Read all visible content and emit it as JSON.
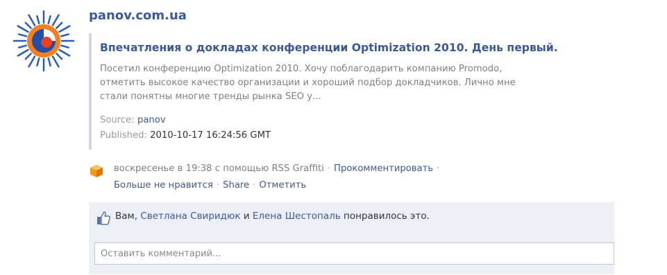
{
  "author": {
    "name": "panov.com.ua",
    "avatar_icon": "sun-logo-icon"
  },
  "post": {
    "title": "Впечатления о докладах конференции Optimization 2010. День первый.",
    "body_lines": [
      "Посетил конференцию Optimization 2010. Хочу поблагодарить компанию Promodo,",
      "отметить высокое качество организации и хороший подбор докладчиков. Лично мне",
      "стали понятны многие тренды рынка SEO у..."
    ],
    "source_label": "Source:",
    "source_value": "panov",
    "published_label": "Published:",
    "published_value": "2010-10-17 16:24:56 GMT"
  },
  "actions": {
    "app_icon": "rss-graffiti-icon",
    "time": "воскресенье в 19:38",
    "via": "с помощью",
    "app_name": "RSS Graffiti",
    "comment_link": "Прокомментировать",
    "unlike_link": "Больше не нравится",
    "share_link": "Share",
    "tag_link": "Отметить",
    "separator": "·"
  },
  "likes": {
    "icon": "thumbs-up-icon",
    "you": "Вам,",
    "person1": "Светлана Свиридюк",
    "conj": "и",
    "person2": "Елена Шестопаль",
    "suffix": "понравилось это."
  },
  "comment": {
    "placeholder": "Оставить комментарий..."
  },
  "colors": {
    "link": "#3b5998",
    "box_bg": "#eceff5",
    "muted": "#808080"
  }
}
